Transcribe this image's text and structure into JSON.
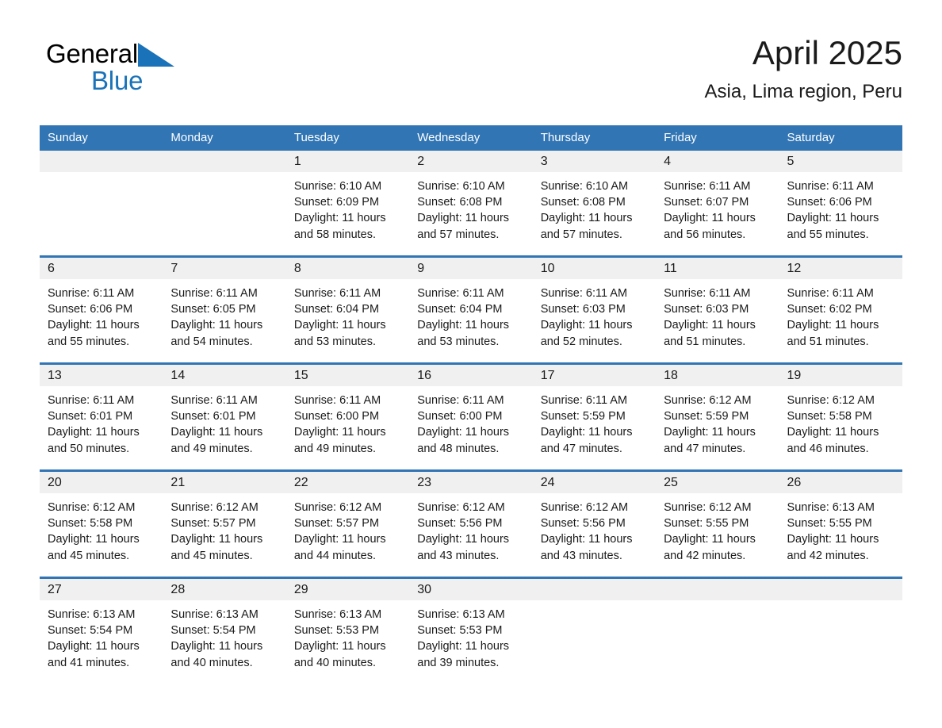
{
  "brand": {
    "word1": "General",
    "word2": "Blue",
    "triangle_color": "#1a72b8",
    "text_color": "#000000",
    "blue_text_color": "#1a72b8"
  },
  "header": {
    "title": "April 2025",
    "subtitle": "Asia, Lima region, Peru"
  },
  "colors": {
    "header_blue": "#3175b4",
    "row_divider_blue": "#3175b4",
    "daynum_band": "#f0f0f0",
    "text": "#1a1a1a",
    "page_background": "#ffffff"
  },
  "weekday_headers": [
    "Sunday",
    "Monday",
    "Tuesday",
    "Wednesday",
    "Thursday",
    "Friday",
    "Saturday"
  ],
  "weeks": [
    [
      {
        "day": "",
        "sunrise": "",
        "sunset": "",
        "daylight_l1": "",
        "daylight_l2": ""
      },
      {
        "day": "",
        "sunrise": "",
        "sunset": "",
        "daylight_l1": "",
        "daylight_l2": ""
      },
      {
        "day": "1",
        "sunrise": "Sunrise: 6:10 AM",
        "sunset": "Sunset: 6:09 PM",
        "daylight_l1": "Daylight: 11 hours",
        "daylight_l2": "and 58 minutes."
      },
      {
        "day": "2",
        "sunrise": "Sunrise: 6:10 AM",
        "sunset": "Sunset: 6:08 PM",
        "daylight_l1": "Daylight: 11 hours",
        "daylight_l2": "and 57 minutes."
      },
      {
        "day": "3",
        "sunrise": "Sunrise: 6:10 AM",
        "sunset": "Sunset: 6:08 PM",
        "daylight_l1": "Daylight: 11 hours",
        "daylight_l2": "and 57 minutes."
      },
      {
        "day": "4",
        "sunrise": "Sunrise: 6:11 AM",
        "sunset": "Sunset: 6:07 PM",
        "daylight_l1": "Daylight: 11 hours",
        "daylight_l2": "and 56 minutes."
      },
      {
        "day": "5",
        "sunrise": "Sunrise: 6:11 AM",
        "sunset": "Sunset: 6:06 PM",
        "daylight_l1": "Daylight: 11 hours",
        "daylight_l2": "and 55 minutes."
      }
    ],
    [
      {
        "day": "6",
        "sunrise": "Sunrise: 6:11 AM",
        "sunset": "Sunset: 6:06 PM",
        "daylight_l1": "Daylight: 11 hours",
        "daylight_l2": "and 55 minutes."
      },
      {
        "day": "7",
        "sunrise": "Sunrise: 6:11 AM",
        "sunset": "Sunset: 6:05 PM",
        "daylight_l1": "Daylight: 11 hours",
        "daylight_l2": "and 54 minutes."
      },
      {
        "day": "8",
        "sunrise": "Sunrise: 6:11 AM",
        "sunset": "Sunset: 6:04 PM",
        "daylight_l1": "Daylight: 11 hours",
        "daylight_l2": "and 53 minutes."
      },
      {
        "day": "9",
        "sunrise": "Sunrise: 6:11 AM",
        "sunset": "Sunset: 6:04 PM",
        "daylight_l1": "Daylight: 11 hours",
        "daylight_l2": "and 53 minutes."
      },
      {
        "day": "10",
        "sunrise": "Sunrise: 6:11 AM",
        "sunset": "Sunset: 6:03 PM",
        "daylight_l1": "Daylight: 11 hours",
        "daylight_l2": "and 52 minutes."
      },
      {
        "day": "11",
        "sunrise": "Sunrise: 6:11 AM",
        "sunset": "Sunset: 6:03 PM",
        "daylight_l1": "Daylight: 11 hours",
        "daylight_l2": "and 51 minutes."
      },
      {
        "day": "12",
        "sunrise": "Sunrise: 6:11 AM",
        "sunset": "Sunset: 6:02 PM",
        "daylight_l1": "Daylight: 11 hours",
        "daylight_l2": "and 51 minutes."
      }
    ],
    [
      {
        "day": "13",
        "sunrise": "Sunrise: 6:11 AM",
        "sunset": "Sunset: 6:01 PM",
        "daylight_l1": "Daylight: 11 hours",
        "daylight_l2": "and 50 minutes."
      },
      {
        "day": "14",
        "sunrise": "Sunrise: 6:11 AM",
        "sunset": "Sunset: 6:01 PM",
        "daylight_l1": "Daylight: 11 hours",
        "daylight_l2": "and 49 minutes."
      },
      {
        "day": "15",
        "sunrise": "Sunrise: 6:11 AM",
        "sunset": "Sunset: 6:00 PM",
        "daylight_l1": "Daylight: 11 hours",
        "daylight_l2": "and 49 minutes."
      },
      {
        "day": "16",
        "sunrise": "Sunrise: 6:11 AM",
        "sunset": "Sunset: 6:00 PM",
        "daylight_l1": "Daylight: 11 hours",
        "daylight_l2": "and 48 minutes."
      },
      {
        "day": "17",
        "sunrise": "Sunrise: 6:11 AM",
        "sunset": "Sunset: 5:59 PM",
        "daylight_l1": "Daylight: 11 hours",
        "daylight_l2": "and 47 minutes."
      },
      {
        "day": "18",
        "sunrise": "Sunrise: 6:12 AM",
        "sunset": "Sunset: 5:59 PM",
        "daylight_l1": "Daylight: 11 hours",
        "daylight_l2": "and 47 minutes."
      },
      {
        "day": "19",
        "sunrise": "Sunrise: 6:12 AM",
        "sunset": "Sunset: 5:58 PM",
        "daylight_l1": "Daylight: 11 hours",
        "daylight_l2": "and 46 minutes."
      }
    ],
    [
      {
        "day": "20",
        "sunrise": "Sunrise: 6:12 AM",
        "sunset": "Sunset: 5:58 PM",
        "daylight_l1": "Daylight: 11 hours",
        "daylight_l2": "and 45 minutes."
      },
      {
        "day": "21",
        "sunrise": "Sunrise: 6:12 AM",
        "sunset": "Sunset: 5:57 PM",
        "daylight_l1": "Daylight: 11 hours",
        "daylight_l2": "and 45 minutes."
      },
      {
        "day": "22",
        "sunrise": "Sunrise: 6:12 AM",
        "sunset": "Sunset: 5:57 PM",
        "daylight_l1": "Daylight: 11 hours",
        "daylight_l2": "and 44 minutes."
      },
      {
        "day": "23",
        "sunrise": "Sunrise: 6:12 AM",
        "sunset": "Sunset: 5:56 PM",
        "daylight_l1": "Daylight: 11 hours",
        "daylight_l2": "and 43 minutes."
      },
      {
        "day": "24",
        "sunrise": "Sunrise: 6:12 AM",
        "sunset": "Sunset: 5:56 PM",
        "daylight_l1": "Daylight: 11 hours",
        "daylight_l2": "and 43 minutes."
      },
      {
        "day": "25",
        "sunrise": "Sunrise: 6:12 AM",
        "sunset": "Sunset: 5:55 PM",
        "daylight_l1": "Daylight: 11 hours",
        "daylight_l2": "and 42 minutes."
      },
      {
        "day": "26",
        "sunrise": "Sunrise: 6:13 AM",
        "sunset": "Sunset: 5:55 PM",
        "daylight_l1": "Daylight: 11 hours",
        "daylight_l2": "and 42 minutes."
      }
    ],
    [
      {
        "day": "27",
        "sunrise": "Sunrise: 6:13 AM",
        "sunset": "Sunset: 5:54 PM",
        "daylight_l1": "Daylight: 11 hours",
        "daylight_l2": "and 41 minutes."
      },
      {
        "day": "28",
        "sunrise": "Sunrise: 6:13 AM",
        "sunset": "Sunset: 5:54 PM",
        "daylight_l1": "Daylight: 11 hours",
        "daylight_l2": "and 40 minutes."
      },
      {
        "day": "29",
        "sunrise": "Sunrise: 6:13 AM",
        "sunset": "Sunset: 5:53 PM",
        "daylight_l1": "Daylight: 11 hours",
        "daylight_l2": "and 40 minutes."
      },
      {
        "day": "30",
        "sunrise": "Sunrise: 6:13 AM",
        "sunset": "Sunset: 5:53 PM",
        "daylight_l1": "Daylight: 11 hours",
        "daylight_l2": "and 39 minutes."
      },
      {
        "day": "",
        "sunrise": "",
        "sunset": "",
        "daylight_l1": "",
        "daylight_l2": ""
      },
      {
        "day": "",
        "sunrise": "",
        "sunset": "",
        "daylight_l1": "",
        "daylight_l2": ""
      },
      {
        "day": "",
        "sunrise": "",
        "sunset": "",
        "daylight_l1": "",
        "daylight_l2": ""
      }
    ]
  ]
}
